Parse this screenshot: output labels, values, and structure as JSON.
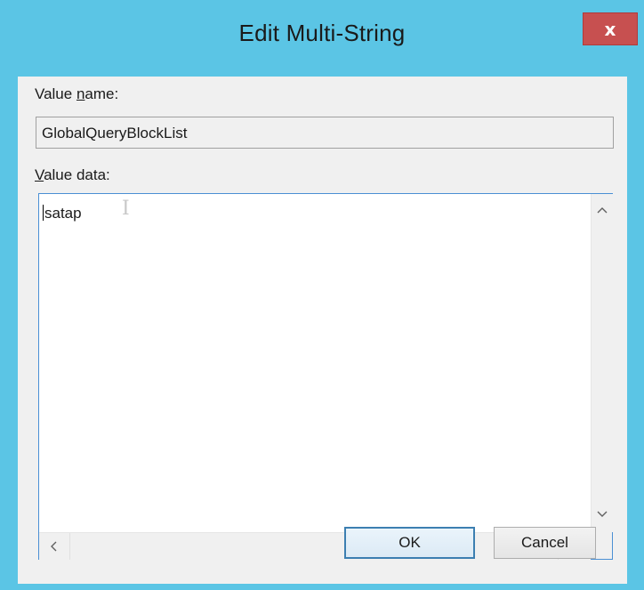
{
  "window": {
    "title": "Edit Multi-String",
    "close_glyph": "x",
    "colors": {
      "titlebar": "#5bc5e5",
      "close_button": "#c75050",
      "client": "#f0f0f0",
      "focus_border": "#4a8fd4"
    }
  },
  "value_name": {
    "label_underlined": "n",
    "label_pre": "Value ",
    "label_post": "ame:",
    "value": "GlobalQueryBlockList"
  },
  "value_data": {
    "label_underlined": "V",
    "label_post": "alue data:",
    "text": "satap"
  },
  "scrollbar": {
    "up_icon": "chevron-up-icon",
    "down_icon": "chevron-down-icon",
    "left_icon": "chevron-left-icon",
    "right_icon": "chevron-right-icon"
  },
  "buttons": {
    "ok_label": "OK",
    "cancel_label": "Cancel"
  }
}
